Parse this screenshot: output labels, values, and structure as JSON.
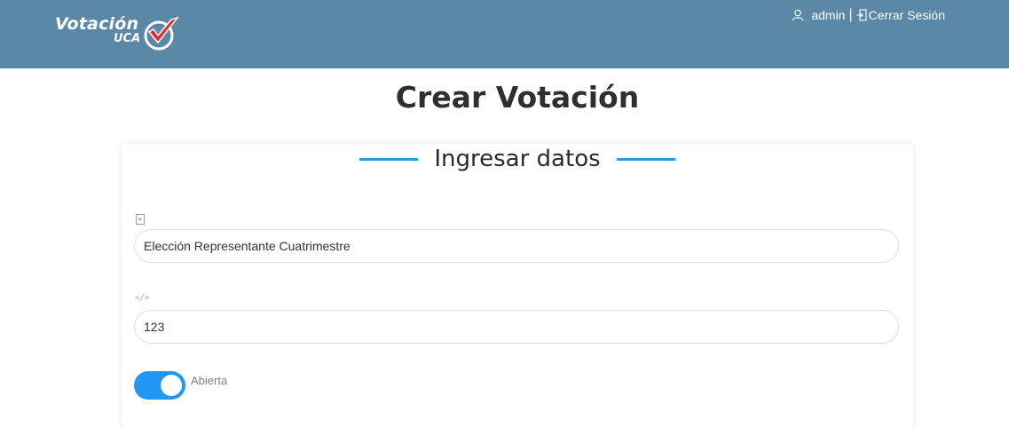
{
  "header": {
    "logo_text": "Votación",
    "logo_sub": "UCA",
    "user_name": "admin",
    "separator": "|",
    "logout_label": "Cerrar Sesión",
    "color": "#5a88a6"
  },
  "page": {
    "title": "Crear Votación"
  },
  "form": {
    "section_title": "Ingresar datos",
    "name_icon": "form-entry-icon",
    "name_value": "Elección Representante Cuatrimestre",
    "code_icon": "code-icon",
    "code_value": "123",
    "status_label": "Abierta",
    "status_on": true,
    "accent_color": "#23a0dc",
    "toggle_color": "#2196f3"
  }
}
